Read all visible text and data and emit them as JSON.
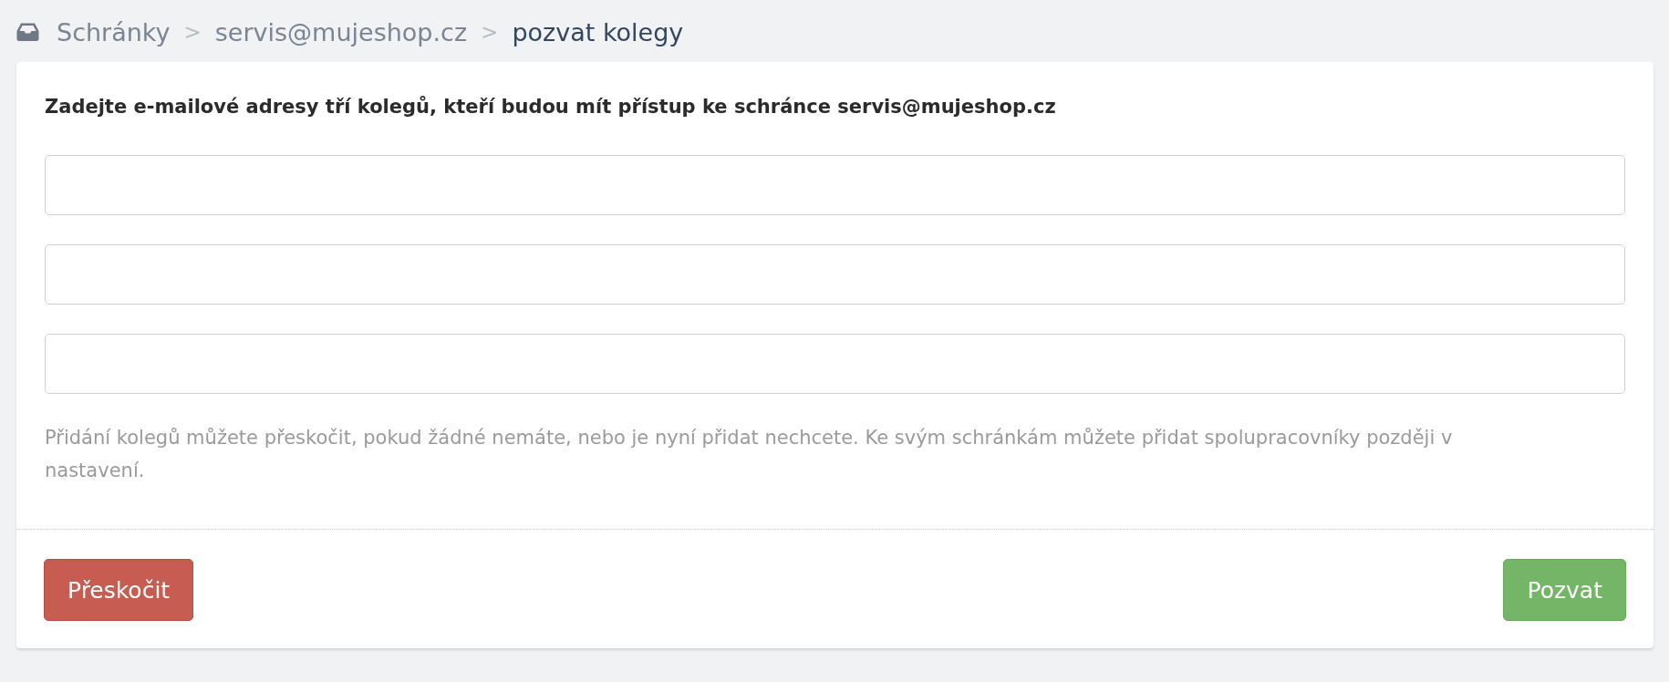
{
  "breadcrumb": {
    "items": [
      {
        "kind": "link",
        "label": "Schránky",
        "current": false
      },
      {
        "kind": "separator",
        "label": ">"
      },
      {
        "kind": "link",
        "label": "servis@mujeshop.cz",
        "current": false
      },
      {
        "kind": "separator",
        "label": ">"
      },
      {
        "kind": "link",
        "label": "pozvat kolegy",
        "current": true
      }
    ]
  },
  "form": {
    "prompt": "Zadejte e-mailové adresy tří kolegů, kteří budou mít přístup ke schránce servis@mujeshop.cz",
    "fields": [
      {
        "kind": "email"
      },
      {
        "kind": "email"
      },
      {
        "kind": "email"
      }
    ],
    "help_text": "Přidání kolegů můžete přeskočit, pokud žádné nemáte, nebo je nyní přidat nechcete. Ke svým schránkám můžete přidat spolupracovníky později v nastavení."
  },
  "buttons": [
    {
      "kind": "danger",
      "label": "Přeskočit"
    },
    {
      "kind": "success",
      "label": "Pozvat"
    }
  ]
}
